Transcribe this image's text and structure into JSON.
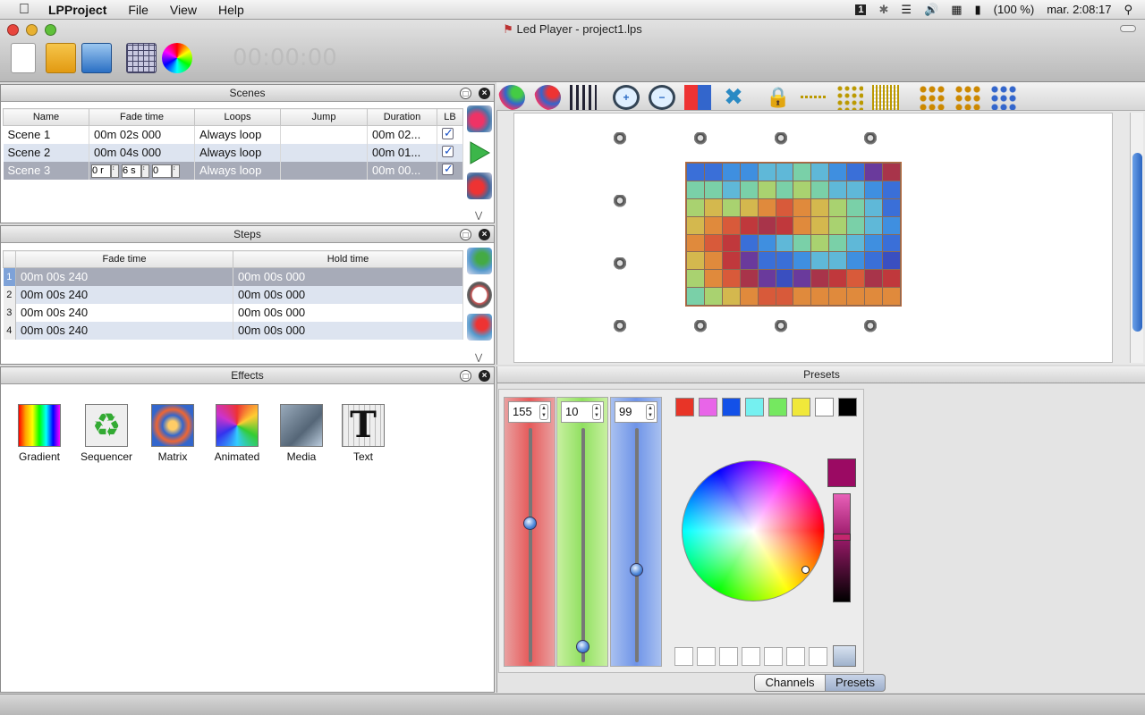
{
  "menubar": {
    "app_name": "LPProject",
    "items": [
      "File",
      "View",
      "Help"
    ],
    "status": {
      "battery": "(100 %)",
      "clock": "mar. 2:08:17"
    }
  },
  "window": {
    "title": "Led Player - project1.lps",
    "timer": "00:00:00"
  },
  "scenes": {
    "title": "Scenes",
    "columns": [
      "Name",
      "Fade time",
      "Loops",
      "Jump",
      "Duration",
      "LB"
    ],
    "rows": [
      {
        "name": "Scene 1",
        "fade": "00m 02s 000",
        "loops": "Always loop",
        "jump": "",
        "duration": "00m 02..."
      },
      {
        "name": "Scene 2",
        "fade": "00m 04s 000",
        "loops": "Always loop",
        "jump": "",
        "duration": "00m 01..."
      },
      {
        "name": "Scene 3",
        "fade_fields": [
          "0 r",
          "6 s",
          "0"
        ],
        "loops": "Always loop",
        "jump": "",
        "duration": "00m 00..."
      }
    ]
  },
  "steps": {
    "title": "Steps",
    "columns": [
      "Fade time",
      "Hold time"
    ],
    "rows": [
      {
        "n": "1",
        "fade": "00m 00s 240",
        "hold": "00m 00s 000"
      },
      {
        "n": "2",
        "fade": "00m 00s 240",
        "hold": "00m 00s 000"
      },
      {
        "n": "3",
        "fade": "00m 00s 240",
        "hold": "00m 00s 000"
      },
      {
        "n": "4",
        "fade": "00m 00s 240",
        "hold": "00m 00s 000"
      }
    ]
  },
  "effects": {
    "title": "Effects",
    "items": [
      "Gradient",
      "Sequencer",
      "Matrix",
      "Animated",
      "Media",
      "Text"
    ]
  },
  "presets": {
    "title": "Presets",
    "red": 155,
    "green": 10,
    "blue": 99,
    "red_level": 0.6,
    "green_level": 0.04,
    "blue_level": 0.39,
    "swatches": [
      "#e83427",
      "#e865e8",
      "#1351e8",
      "#75f0f0",
      "#75e860",
      "#f0e83a",
      "#ffffff",
      "#000000"
    ],
    "current_color": "#9b0a63",
    "tabs": [
      "Channels",
      "Presets"
    ],
    "active_tab": "Presets"
  },
  "colors": {
    "accent_selected": "#a7abb8",
    "row_alt": "#dde4f0"
  }
}
